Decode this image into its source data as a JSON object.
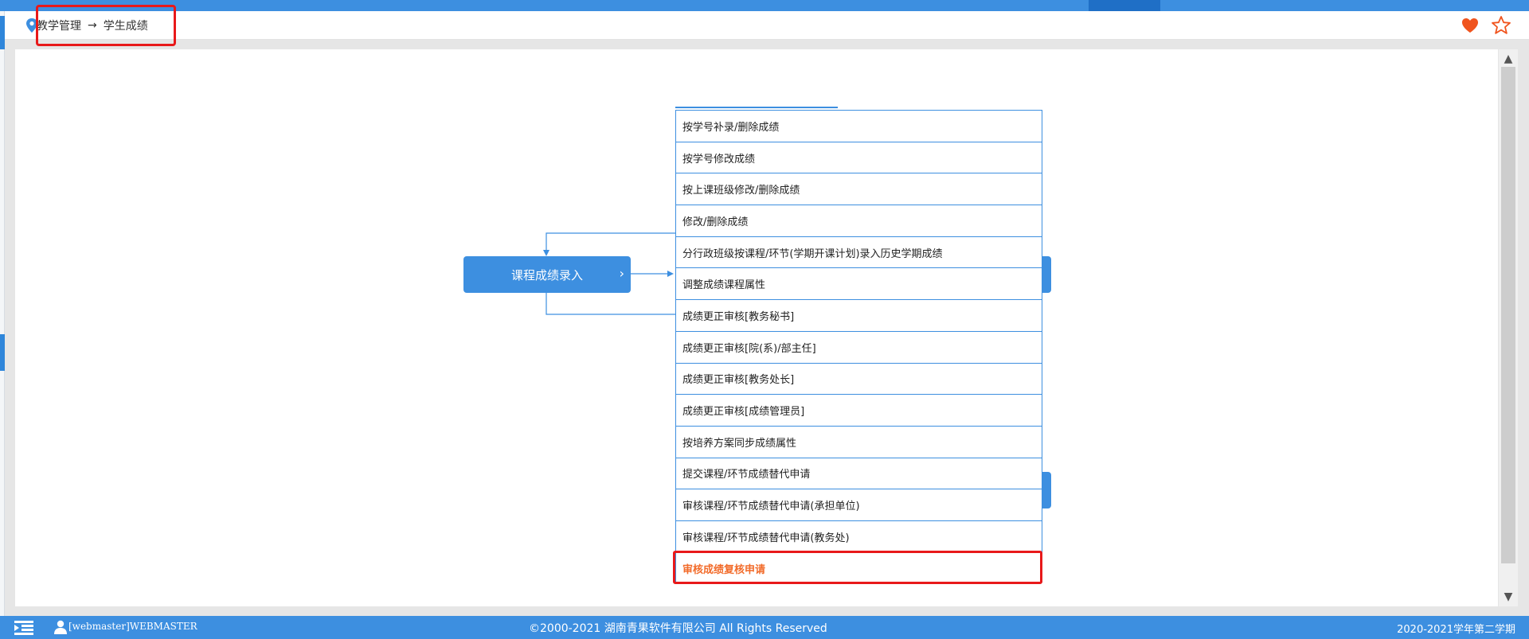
{
  "breadcrumb": {
    "parent": "教学管理",
    "separator": "→",
    "current": "学生成绩"
  },
  "diagram": {
    "main_node": "课程成绩录入"
  },
  "menu": {
    "items": [
      "按学号补录/删除成绩",
      "按学号修改成绩",
      "按上课班级修改/删除成绩",
      "修改/删除成绩",
      "分行政班级按课程/环节(学期开课计划)录入历史学期成绩",
      "调整成绩课程属性",
      "成绩更正审核[教务秘书]",
      "成绩更正审核[院(系)/部主任]",
      "成绩更正审核[教务处长]",
      "成绩更正审核[成绩管理员]",
      "按培养方案同步成绩属性",
      "提交课程/环节成绩替代申请",
      "审核课程/环节成绩替代申请(承担单位)",
      "审核课程/环节成绩替代申请(教务处)",
      "审核成绩复核申请"
    ],
    "active_index": 14
  },
  "footer": {
    "user": "[webmaster]WEBMASTER",
    "copyright": "©2000-2021 湖南青果软件有限公司 All Rights Reserved",
    "term": "2020-2021学年第二学期"
  },
  "colors": {
    "primary": "#3d8fe0",
    "highlight": "#e8191a",
    "active_text": "#f26b2a",
    "heart": "#f0541e"
  },
  "icons": [
    "location-pin-icon",
    "heart-icon",
    "star-outline-icon",
    "chevron-right-icon",
    "menu-toggle-icon",
    "user-icon",
    "scroll-up-icon",
    "scroll-down-icon"
  ]
}
